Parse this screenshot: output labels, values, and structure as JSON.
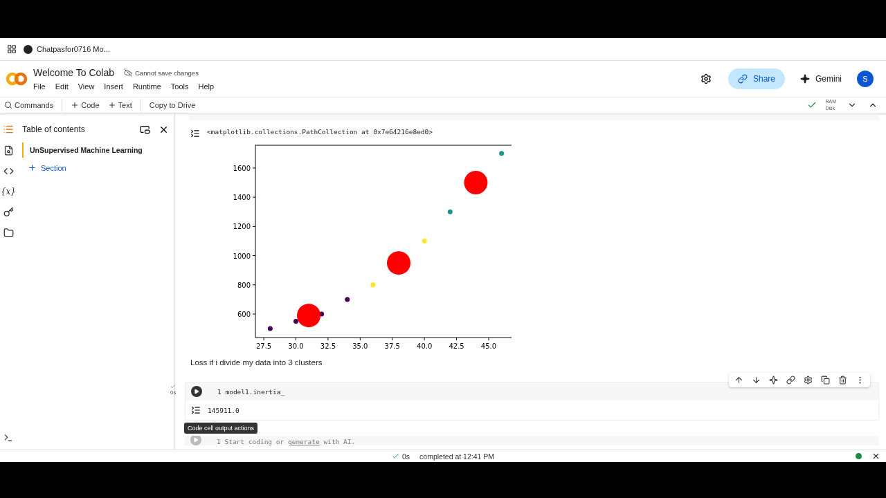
{
  "browser_tab": {
    "title": "Chatpasfor0716 Mo..."
  },
  "header": {
    "title": "Welcome To Colab",
    "save_status": "Cannot save changes",
    "share": "Share",
    "gemini": "Gemini",
    "avatar": "S"
  },
  "menu": [
    "File",
    "Edit",
    "View",
    "Insert",
    "Runtime",
    "Tools",
    "Help"
  ],
  "toolbar": {
    "commands": "Commands",
    "code": "Code",
    "text": "Text",
    "copy": "Copy to Drive",
    "ram": "RAM",
    "disk": "Disk",
    "connected": true
  },
  "rail": {
    "variables": "{x}"
  },
  "sidebar": {
    "title": "Table of contents",
    "items": [
      {
        "label": "UnSupervised Machine Learning",
        "selected": true
      }
    ],
    "add_section": "Section"
  },
  "output_1": {
    "text": "<matplotlib.collections.PathCollection at 0x7e64216e8ed0>",
    "chart_data": {
      "type": "scatter",
      "xlim": [
        26.85,
        46.94
      ],
      "ylim": [
        439,
        1756
      ],
      "xticks": [
        {
          "value": 27.5,
          "label": "27.5"
        },
        {
          "value": 30,
          "label": "30.0"
        },
        {
          "value": 32.5,
          "label": "32.5"
        },
        {
          "value": 35,
          "label": "35.0"
        },
        {
          "value": 37.5,
          "label": "37.5"
        },
        {
          "value": 40,
          "label": "40.0"
        },
        {
          "value": 42.5,
          "label": "42.5"
        },
        {
          "value": 45,
          "label": "45.0"
        }
      ],
      "yticks": [
        600,
        800,
        1000,
        1200,
        1400,
        1600
      ],
      "series": [
        {
          "color": "#440154",
          "x": [
            28,
            30,
            32,
            34
          ],
          "values": [
            500,
            550,
            600,
            700
          ]
        },
        {
          "color": "#fde725",
          "x": [
            36,
            40
          ],
          "values": [
            800,
            1100
          ]
        },
        {
          "color": "#21918c",
          "x": [
            42,
            46
          ],
          "values": [
            1300,
            1700
          ]
        },
        {
          "color": "#ff0000",
          "x": [
            31,
            38,
            44
          ],
          "values": [
            590,
            950,
            1500
          ]
        }
      ]
    }
  },
  "text_cell": "Loss if i divide my data into 3 clusters",
  "code_cell": {
    "line": "1",
    "code": "model1.inertia_",
    "exec_time": "0s",
    "output": "145911.0",
    "tooltip": "Code cell output actions"
  },
  "empty_cell": {
    "line": "1",
    "prefix": "Start coding or ",
    "link": "generate",
    "suffix": " with AI."
  },
  "status": {
    "time": "0s",
    "text": "completed at 12:41 PM"
  }
}
